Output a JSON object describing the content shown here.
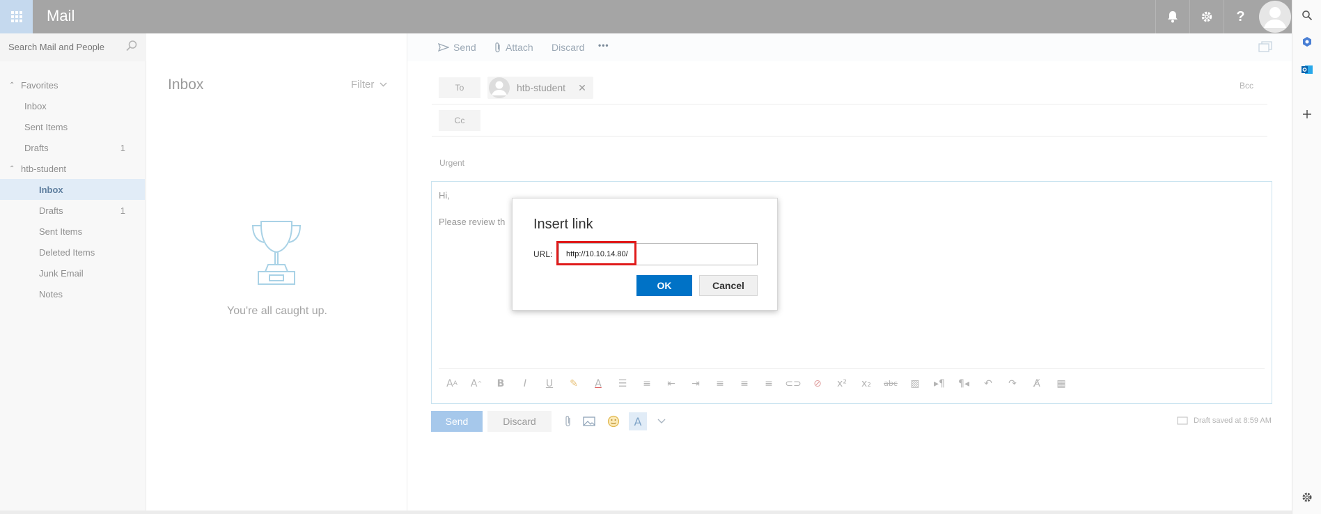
{
  "app": {
    "title": "Mail"
  },
  "colors": {
    "topbar": "#a5a5a5",
    "accent": "#0072c6",
    "highlight_box": "#e01b1b"
  },
  "topbar": {
    "icons": [
      "bell-icon",
      "gear-icon",
      "help-icon",
      "user-avatar"
    ]
  },
  "right_rail": {
    "icons": [
      "search-icon",
      "office-icon",
      "outlook-icon",
      "plus-icon",
      "settings-icon"
    ]
  },
  "search": {
    "placeholder": "Search Mail and People"
  },
  "nav": {
    "favorites_header": "Favorites",
    "favorites": [
      {
        "label": "Inbox",
        "count": ""
      },
      {
        "label": "Sent Items",
        "count": ""
      },
      {
        "label": "Drafts",
        "count": "1"
      }
    ],
    "account_header": "htb-student",
    "folders": [
      {
        "label": "Inbox",
        "count": "",
        "selected": true
      },
      {
        "label": "Drafts",
        "count": "1"
      },
      {
        "label": "Sent Items",
        "count": ""
      },
      {
        "label": "Deleted Items",
        "count": ""
      },
      {
        "label": "Junk Email",
        "count": ""
      },
      {
        "label": "Notes",
        "count": ""
      }
    ]
  },
  "message_list": {
    "title": "Inbox",
    "filter_label": "Filter",
    "empty_text": "You're all caught up."
  },
  "compose": {
    "toolbar": {
      "send": "Send",
      "attach": "Attach",
      "discard": "Discard",
      "more": "•••"
    },
    "to_label": "To",
    "recipient": "htb-student",
    "remove": "✕",
    "cc_label": "Cc",
    "bcc_label": "Bcc",
    "importance": "Urgent",
    "body_line1": "Hi,",
    "body_line2": "Please review th",
    "send_button": "Send",
    "discard_button": "Discard",
    "draft_status": "Draft saved at 8:59 AM"
  },
  "dialog": {
    "title": "Insert link",
    "url_label": "URL:",
    "url_value": "http://10.10.14.80/",
    "ok": "OK",
    "cancel": "Cancel"
  }
}
